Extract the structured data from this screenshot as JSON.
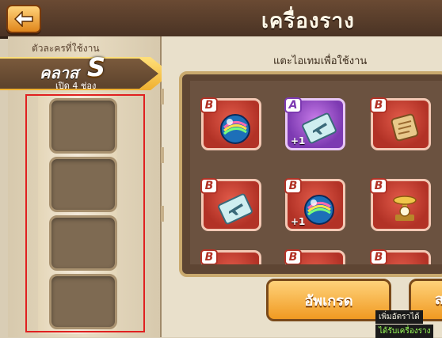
{
  "header": {
    "title": "เครื่องราง"
  },
  "left": {
    "label_top": "ตัวละครที่ใช้งาน",
    "class_word": "คลาส",
    "class_letter": "S",
    "slots_open": "เปิด 4 ช่อง",
    "slot_count": 4
  },
  "right": {
    "hint": "แตะไอเทมเพื่อใช้งาน",
    "items": [
      {
        "grade": "B",
        "icon": "blue-orb-icon",
        "plus": ""
      },
      {
        "grade": "A",
        "icon": "flight-ticket-icon",
        "plus": "+1"
      },
      {
        "grade": "B",
        "icon": "scroll-icon",
        "plus": ""
      },
      {
        "grade": "B",
        "icon": "flight-ticket-icon",
        "plus": ""
      },
      {
        "grade": "B",
        "icon": "blue-orb-icon",
        "plus": "+1"
      },
      {
        "grade": "B",
        "icon": "scale-icon",
        "plus": ""
      },
      {
        "grade": "B",
        "icon": "blue-orb-icon",
        "plus": ""
      },
      {
        "grade": "B",
        "icon": "scale-icon",
        "plus": ""
      },
      {
        "grade": "B",
        "icon": "scale-icon",
        "plus": ""
      }
    ]
  },
  "buttons": {
    "upgrade": "อัพเกรด",
    "second": "ส"
  },
  "tips": {
    "line1": "เพิ่มอัตราได้",
    "line2": "ได้รับเครื่องราง"
  }
}
